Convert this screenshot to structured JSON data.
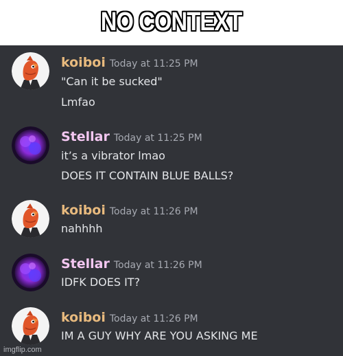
{
  "caption": "NO CONTEXT",
  "messages": [
    {
      "author": "koiboi",
      "time": "Today at 11:25 PM",
      "lines": [
        "\"Can it be sucked\"",
        "Lmfao"
      ]
    },
    {
      "author": "Stellar",
      "time": "Today at 11:25 PM",
      "lines": [
        "it’s a vibrator lmao",
        "DOES IT CONTAIN BLUE BALLS?"
      ]
    },
    {
      "author": "koiboi",
      "time": "Today at 11:26 PM",
      "lines": [
        "nahhhh"
      ]
    },
    {
      "author": "Stellar",
      "time": "Today at 11:26 PM",
      "lines": [
        "IDFK DOES IT?"
      ]
    },
    {
      "author": "koiboi",
      "time": "Today at 11:26 PM",
      "lines": [
        "IM A GUY WHY ARE YOU ASKING ME"
      ]
    }
  ],
  "watermark": "imgflip.com",
  "colors": {
    "chat_background": "#313338",
    "koiboi_name": "#e8ba7e",
    "stellar_name": "#f3c7f1",
    "message_text": "#e3e5e8",
    "timestamp": "#a7aab2"
  },
  "avatars": {
    "koiboi": "koi-fish-avatar",
    "Stellar": "purple-orb-avatar"
  }
}
